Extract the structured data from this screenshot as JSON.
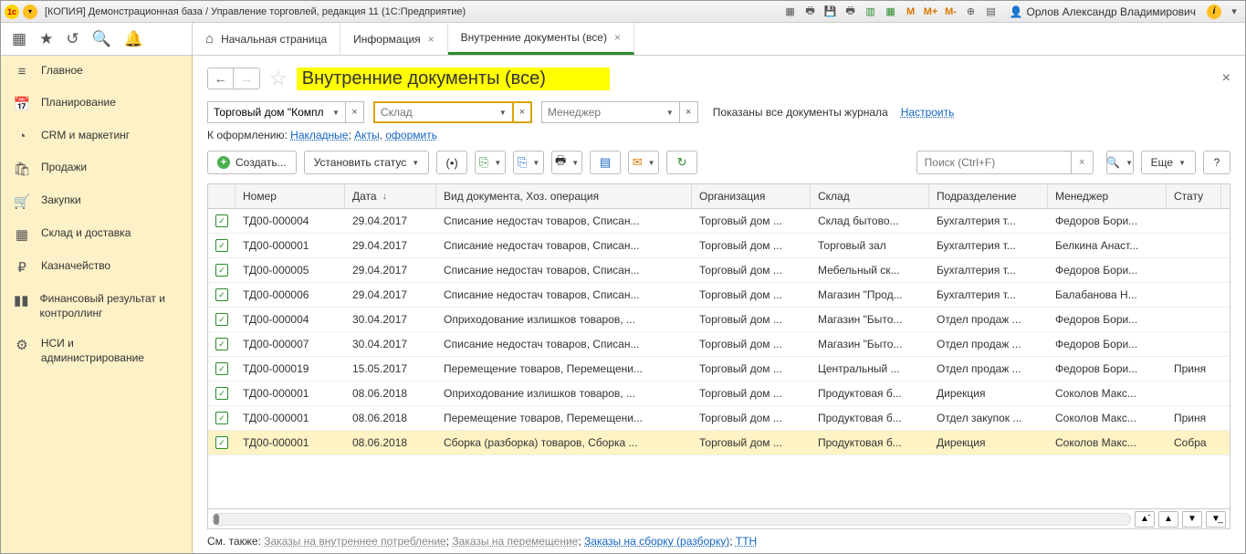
{
  "titlebar": {
    "title": "[КОПИЯ] Демонстрационная база / Управление торговлей, редакция 11  (1С:Предприятие)",
    "user": "Орлов Александр Владимирович",
    "mbuttons": [
      "M",
      "M+",
      "M-"
    ]
  },
  "tabs": {
    "home": "Начальная страница",
    "items": [
      {
        "label": "Информация",
        "active": false
      },
      {
        "label": "Внутренние документы (все)",
        "active": true
      }
    ]
  },
  "sidebar": [
    {
      "icon": "≡",
      "label": "Главное"
    },
    {
      "icon": "📅",
      "label": "Планирование"
    },
    {
      "icon": "◔",
      "label": "CRM и маркетинг"
    },
    {
      "icon": "🛍",
      "label": "Продажи"
    },
    {
      "icon": "🛒",
      "label": "Закупки"
    },
    {
      "icon": "▦",
      "label": "Склад и доставка"
    },
    {
      "icon": "₽",
      "label": "Казначейство"
    },
    {
      "icon": "▮▮",
      "label": "Финансовый результат и контроллинг"
    },
    {
      "icon": "⚙",
      "label": "НСИ и администрирование"
    }
  ],
  "page": {
    "title": "Внутренние документы (все)",
    "filter1_value": "Торговый дом \"Комплексн",
    "filter2_placeholder": "Склад",
    "filter3_placeholder": "Менеджер",
    "shown_text": "Показаны все документы журнала",
    "configure": "Настроить",
    "subrow_prefix": "К оформлению:",
    "subrow_links": [
      "Накладные",
      "Акты",
      "оформить"
    ],
    "create": "Создать...",
    "setstatus": "Установить статус",
    "search_placeholder": "Поиск (Ctrl+F)",
    "more": "Еще",
    "help": "?"
  },
  "table": {
    "headers": [
      "",
      "Номер",
      "Дата",
      "Вид документа, Хоз. операция",
      "Организация",
      "Склад",
      "Подразделение",
      "Менеджер",
      "Стату"
    ],
    "sort_col": 2,
    "rows": [
      {
        "num": "ТД00-000004",
        "date": "29.04.2017",
        "doc": "Списание недостач товаров, Списан...",
        "org": "Торговый дом ...",
        "sklad": "Склад бытово...",
        "dep": "Бухгалтерия т...",
        "mgr": "Федоров Бори...",
        "status": ""
      },
      {
        "num": "ТД00-000001",
        "date": "29.04.2017",
        "doc": "Списание недостач товаров, Списан...",
        "org": "Торговый дом ...",
        "sklad": "Торговый зал",
        "dep": "Бухгалтерия т...",
        "mgr": "Белкина Анаст...",
        "status": ""
      },
      {
        "num": "ТД00-000005",
        "date": "29.04.2017",
        "doc": "Списание недостач товаров, Списан...",
        "org": "Торговый дом ...",
        "sklad": "Мебельный ск...",
        "dep": "Бухгалтерия т...",
        "mgr": "Федоров Бори...",
        "status": ""
      },
      {
        "num": "ТД00-000006",
        "date": "29.04.2017",
        "doc": "Списание недостач товаров, Списан...",
        "org": "Торговый дом ...",
        "sklad": "Магазин \"Прод...",
        "dep": "Бухгалтерия т...",
        "mgr": "Балабанова Н...",
        "status": ""
      },
      {
        "num": "ТД00-000004",
        "date": "30.04.2017",
        "doc": "Оприходование излишков товаров, ...",
        "org": "Торговый дом ...",
        "sklad": "Магазин \"Быто...",
        "dep": "Отдел продаж ...",
        "mgr": "Федоров Бори...",
        "status": ""
      },
      {
        "num": "ТД00-000007",
        "date": "30.04.2017",
        "doc": "Списание недостач товаров, Списан...",
        "org": "Торговый дом ...",
        "sklad": "Магазин \"Быто...",
        "dep": "Отдел продаж ...",
        "mgr": "Федоров Бори...",
        "status": ""
      },
      {
        "num": "ТД00-000019",
        "date": "15.05.2017",
        "doc": "Перемещение товаров, Перемещени...",
        "org": "Торговый дом ...",
        "sklad": "Центральный ...",
        "dep": "Отдел продаж ...",
        "mgr": "Федоров Бори...",
        "status": "Приня"
      },
      {
        "num": "ТД00-000001",
        "date": "08.06.2018",
        "doc": "Оприходование излишков товаров, ...",
        "org": "Торговый дом ...",
        "sklad": "Продуктовая б...",
        "dep": "Дирекция",
        "mgr": "Соколов Макс...",
        "status": ""
      },
      {
        "num": "ТД00-000001",
        "date": "08.06.2018",
        "doc": "Перемещение товаров, Перемещени...",
        "org": "Торговый дом ...",
        "sklad": "Продуктовая б...",
        "dep": "Отдел закупок ...",
        "mgr": "Соколов Макс...",
        "status": "Приня"
      },
      {
        "num": "ТД00-000001",
        "date": "08.06.2018",
        "doc": "Сборка (разборка) товаров, Сборка ...",
        "org": "Торговый дом ...",
        "sklad": "Продуктовая б...",
        "dep": "Дирекция",
        "mgr": "Соколов Макс...",
        "status": "Собра",
        "selected": true
      }
    ]
  },
  "footer": {
    "prefix": "См. также:",
    "links": [
      {
        "label": "Заказы на внутреннее потребление",
        "dim": true
      },
      {
        "label": "Заказы на перемещение",
        "dim": true
      },
      {
        "label": "Заказы на сборку (разборку)",
        "dim": false
      },
      {
        "label": "ТТН",
        "dim": false
      }
    ]
  }
}
